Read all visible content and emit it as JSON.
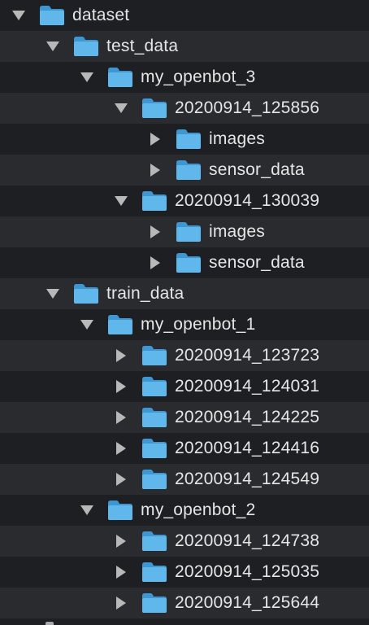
{
  "tree": {
    "rows": [
      {
        "label": "dataset",
        "depth": 0,
        "expanded": true,
        "icon": "folder-icon"
      },
      {
        "label": "test_data",
        "depth": 1,
        "expanded": true,
        "icon": "folder-icon"
      },
      {
        "label": "my_openbot_3",
        "depth": 2,
        "expanded": true,
        "icon": "folder-icon"
      },
      {
        "label": "20200914_125856",
        "depth": 3,
        "expanded": true,
        "icon": "folder-icon"
      },
      {
        "label": "images",
        "depth": 4,
        "expanded": false,
        "icon": "folder-icon"
      },
      {
        "label": "sensor_data",
        "depth": 4,
        "expanded": false,
        "icon": "folder-icon"
      },
      {
        "label": "20200914_130039",
        "depth": 3,
        "expanded": true,
        "icon": "folder-icon"
      },
      {
        "label": "images",
        "depth": 4,
        "expanded": false,
        "icon": "folder-icon"
      },
      {
        "label": "sensor_data",
        "depth": 4,
        "expanded": false,
        "icon": "folder-icon"
      },
      {
        "label": "train_data",
        "depth": 1,
        "expanded": true,
        "icon": "folder-icon"
      },
      {
        "label": "my_openbot_1",
        "depth": 2,
        "expanded": true,
        "icon": "folder-icon"
      },
      {
        "label": "20200914_123723",
        "depth": 3,
        "expanded": false,
        "icon": "folder-icon"
      },
      {
        "label": "20200914_124031",
        "depth": 3,
        "expanded": false,
        "icon": "folder-icon"
      },
      {
        "label": "20200914_124225",
        "depth": 3,
        "expanded": false,
        "icon": "folder-icon"
      },
      {
        "label": "20200914_124416",
        "depth": 3,
        "expanded": false,
        "icon": "folder-icon"
      },
      {
        "label": "20200914_124549",
        "depth": 3,
        "expanded": false,
        "icon": "folder-icon"
      },
      {
        "label": "my_openbot_2",
        "depth": 2,
        "expanded": true,
        "icon": "folder-icon"
      },
      {
        "label": "20200914_124738",
        "depth": 3,
        "expanded": false,
        "icon": "folder-icon"
      },
      {
        "label": "20200914_125035",
        "depth": 3,
        "expanded": false,
        "icon": "folder-icon"
      },
      {
        "label": "20200914_125644",
        "depth": 3,
        "expanded": false,
        "icon": "folder-icon"
      }
    ]
  },
  "colors": {
    "background": "#1e1f22",
    "stripe": "#2a2b2e",
    "text": "#e6e6e6",
    "disclosure": "#b8b8b8",
    "folder_front": "#5fb7ec",
    "folder_back": "#3d97d3"
  }
}
